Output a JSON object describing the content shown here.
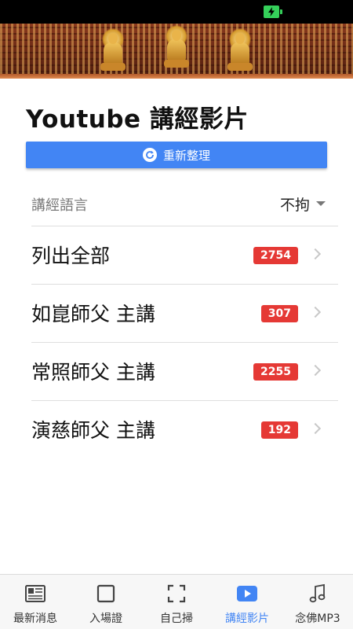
{
  "status_bar": {
    "battery_icon": "battery-charging-icon"
  },
  "header": {
    "title": "Youtube 講經影片"
  },
  "refresh": {
    "label": "重新整理",
    "icon": "refresh-icon"
  },
  "language_filter": {
    "label": "講經語言",
    "selected": "不拘"
  },
  "list": {
    "items": [
      {
        "label": "列出全部",
        "count": "2754"
      },
      {
        "label": "如崑師父 主講",
        "count": "307"
      },
      {
        "label": "常照師父 主講",
        "count": "2255"
      },
      {
        "label": "演慈師父 主講",
        "count": "192"
      }
    ]
  },
  "nav": {
    "active_color": "#4285f4",
    "items": [
      {
        "label": "最新消息",
        "icon": "newspaper-icon"
      },
      {
        "label": "入場證",
        "icon": "square-icon"
      },
      {
        "label": "自己掃",
        "icon": "scan-frame-icon"
      },
      {
        "label": "講經影片",
        "icon": "play-video-icon",
        "active": true
      },
      {
        "label": "念佛MP3",
        "icon": "music-note-icon"
      }
    ]
  }
}
